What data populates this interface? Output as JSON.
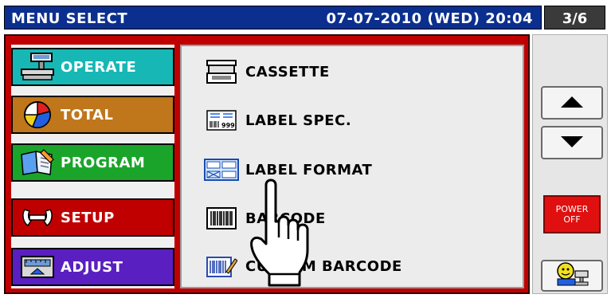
{
  "header": {
    "title": "MENU SELECT",
    "datetime": "07-07-2010 (WED) 20:04",
    "page": "3/6"
  },
  "main_menu": [
    {
      "label": "OPERATE",
      "icon": "scale-icon",
      "color": "#17b7b5"
    },
    {
      "label": "TOTAL",
      "icon": "pie-chart-icon",
      "color": "#c0761a"
    },
    {
      "label": "PROGRAM",
      "icon": "book-icon",
      "color": "#1aa52a"
    },
    {
      "label": "SETUP",
      "icon": "wrench-icon",
      "color": "#c00000"
    },
    {
      "label": "ADJUST",
      "icon": "adjust-gauge-icon",
      "color": "#5a1fc0"
    }
  ],
  "submenu": [
    {
      "label": "CASSETTE",
      "icon": "cassette-icon"
    },
    {
      "label": "LABEL SPEC.",
      "icon": "label-spec-icon"
    },
    {
      "label": "LABEL FORMAT",
      "icon": "label-format-icon"
    },
    {
      "label": "BARCODE",
      "icon": "barcode-icon"
    },
    {
      "label": "CUSTOM BARCODE",
      "icon": "custom-barcode-icon"
    }
  ],
  "side": {
    "power_line1": "POWER",
    "power_line2": "OFF"
  }
}
